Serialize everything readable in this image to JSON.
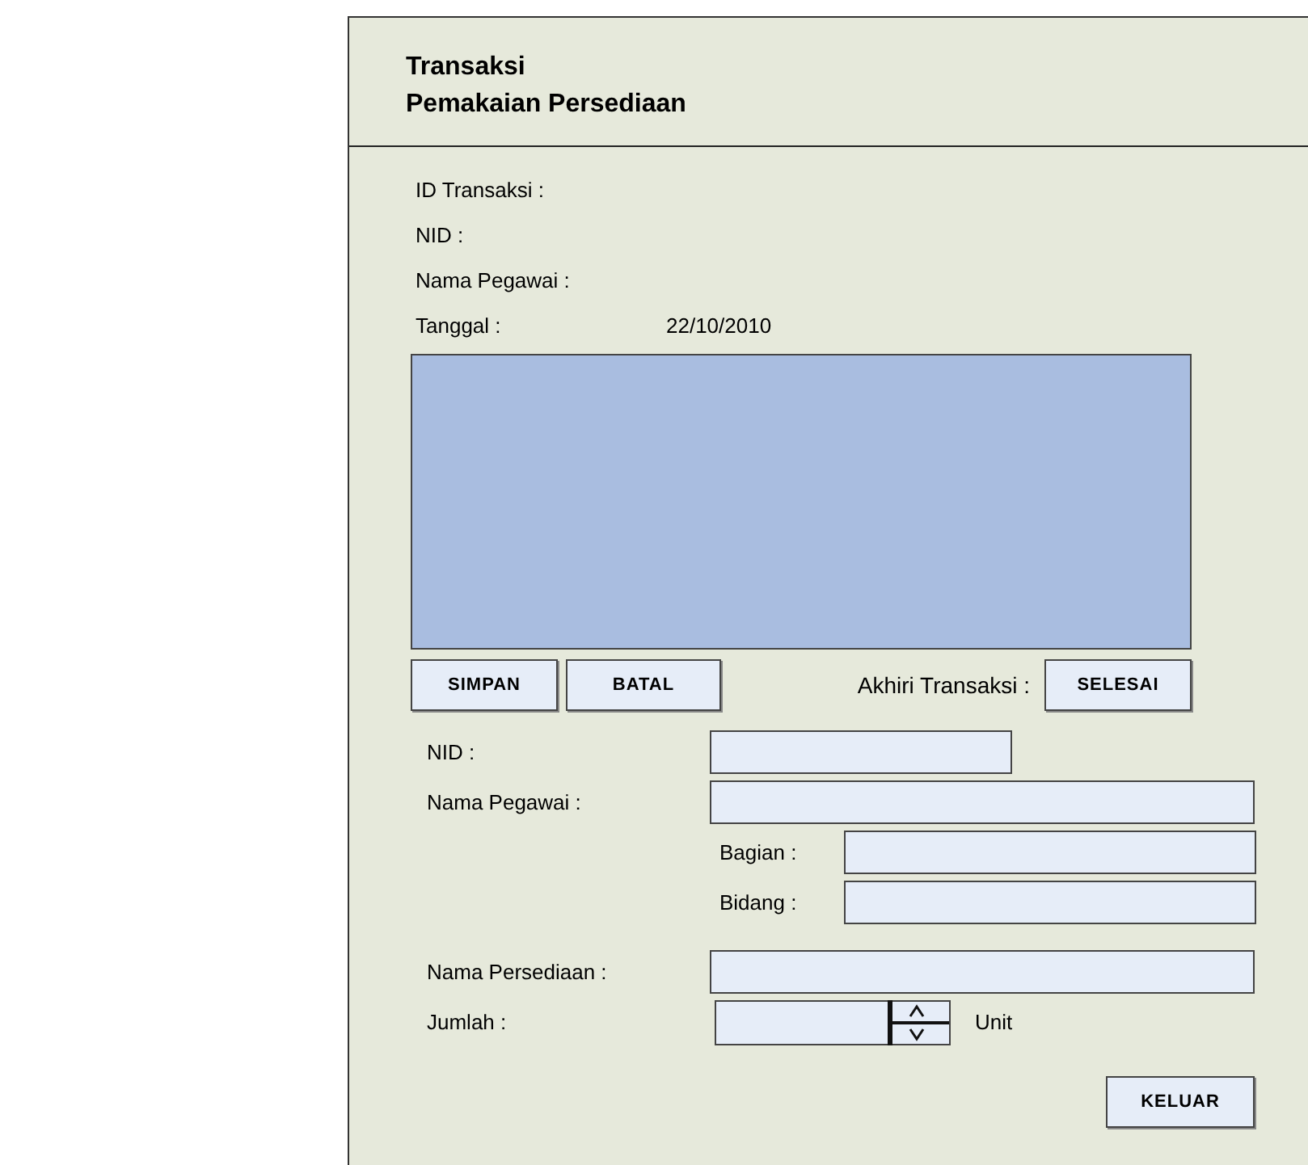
{
  "header": {
    "title_lines": [
      "Transaksi",
      "Pemakaian Persediaan"
    ]
  },
  "info": [
    {
      "label": "ID Transaksi :"
    },
    {
      "label": "NID :"
    },
    {
      "label": "Nama Pegawai :"
    },
    {
      "label": "Tanggal :",
      "value": "22/10/2010"
    }
  ],
  "action_bar": {
    "buttons": [
      "SIMPAN",
      "BATAL"
    ],
    "finish_label": "Akhiri Transaksi :",
    "finish_button": "SELESAI"
  },
  "form": [
    {
      "kind": "short_field",
      "label": "NID :"
    },
    {
      "kind": "field",
      "label": "Nama Pegawai :"
    },
    {
      "kind": "subfield",
      "label": "Bagian :"
    },
    {
      "kind": "subfield",
      "label": "Bidang :"
    },
    {
      "kind": "field",
      "label": "Nama Persediaan :"
    },
    {
      "kind": "spinner",
      "label": "Jumlah :",
      "unit": "Unit"
    }
  ],
  "footer": {
    "button": "KELUAR"
  }
}
